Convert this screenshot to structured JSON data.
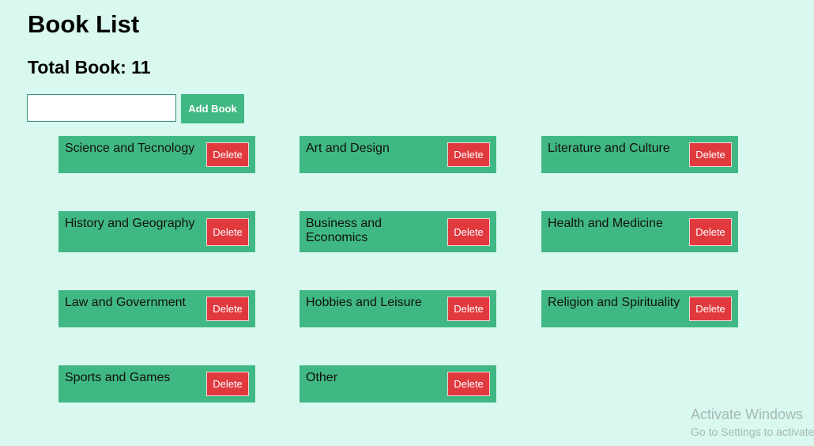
{
  "page": {
    "title": "Book List",
    "total_label": "Total Book: 11"
  },
  "add_form": {
    "input_value": "",
    "button_label": "Add Book"
  },
  "books": [
    {
      "title": "Science and Tecnology",
      "delete_label": "Delete"
    },
    {
      "title": "Art and Design",
      "delete_label": "Delete"
    },
    {
      "title": "Literature and Culture",
      "delete_label": "Delete"
    },
    {
      "title": "History and Geography",
      "delete_label": "Delete"
    },
    {
      "title": "Business and Economics",
      "delete_label": "Delete"
    },
    {
      "title": "Health and Medicine",
      "delete_label": "Delete"
    },
    {
      "title": "Law and Government",
      "delete_label": "Delete"
    },
    {
      "title": "Hobbies and Leisure",
      "delete_label": "Delete"
    },
    {
      "title": "Religion and Spirituality",
      "delete_label": "Delete"
    },
    {
      "title": "Sports and Games",
      "delete_label": "Delete"
    },
    {
      "title": "Other",
      "delete_label": "Delete"
    }
  ],
  "watermark": {
    "line1": "Activate Windows",
    "line2": "Go to Settings to activate Windows."
  },
  "colors": {
    "background": "#d8f8f0",
    "card": "#40b884",
    "delete": "#e0393e"
  }
}
